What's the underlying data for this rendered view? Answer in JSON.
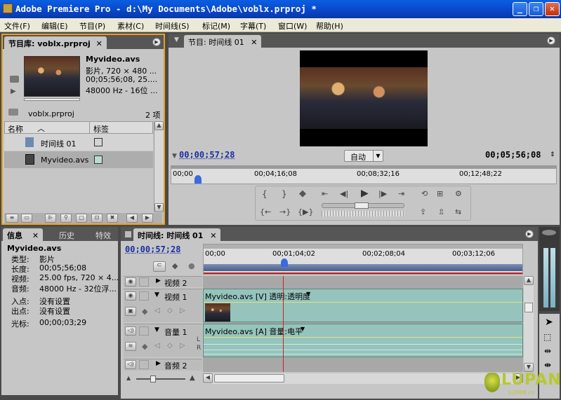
{
  "window": {
    "title": "Adobe Premiere Pro - d:\\My Documents\\Adobe\\voblx.prproj *",
    "minimize": "_",
    "maximize": "❐",
    "close": "✕"
  },
  "menu": [
    "文件(F)",
    "编辑(E)",
    "节目(P)",
    "素材(C)",
    "时间线(S)",
    "标记(M)",
    "字幕(T)",
    "窗口(W)",
    "帮助(H)"
  ],
  "project": {
    "tab": "节目库: voblx.prproj",
    "clip_name": "Myvideo.avs",
    "clip_info": [
      "影片, 720 × 480 ...",
      "00;05;56;08, 25....",
      "48000 Hz - 16位 ..."
    ],
    "project_file": "voblx.prproj",
    "item_count": "2 项",
    "col_name": "名称",
    "col_label": "标签",
    "items": [
      "时间线 01",
      "Myvideo.avs"
    ],
    "label_colors": [
      "#ffffff",
      "#b8dcd0"
    ]
  },
  "monitor": {
    "tab": "节目: 时间线 01",
    "current_time": "00;00;57;28",
    "zoom": "自动",
    "duration": "00;05;56;08",
    "ruler": [
      "00;00",
      "00;04;16;08",
      "00;08;32;16",
      "00;12;48;22"
    ],
    "playhead_fraction": 0.046
  },
  "info": {
    "tabs": [
      "信息",
      "历史",
      "特效"
    ],
    "title": "Myvideo.avs",
    "rows": [
      {
        "k": "类型:",
        "v": "影片"
      },
      {
        "k": "长度:",
        "v": "00;05;56;08"
      },
      {
        "k": "视频:",
        "v": "25.00 fps, 720 × 4..."
      },
      {
        "k": "音频:",
        "v": "48000 Hz - 32位浮..."
      }
    ],
    "in": {
      "k": "入点:",
      "v": "没有设置"
    },
    "out": {
      "k": "出点:",
      "v": "没有设置"
    },
    "cursor": {
      "k": "光标:",
      "v": "00;00;03;29"
    }
  },
  "timeline": {
    "tab": "时间线: 时间线 01",
    "current_time": "00;00;57;28",
    "ruler": [
      "00;00",
      "00;01;04;02",
      "00;02;08;04",
      "00;03;12;06"
    ],
    "tracks": {
      "video2": "视频 2",
      "video1": "视频 1",
      "audio1": "音量 1",
      "audio2": "音频 2"
    },
    "video_clip": "Myvideo.avs [V] 透明:透明度",
    "audio_clip": "Myvideo.avs [A] 音量:电平",
    "lr": [
      "L",
      "R"
    ]
  },
  "watermark": {
    "brand": "LUPAN",
    "url": "LUPAN.cn"
  }
}
